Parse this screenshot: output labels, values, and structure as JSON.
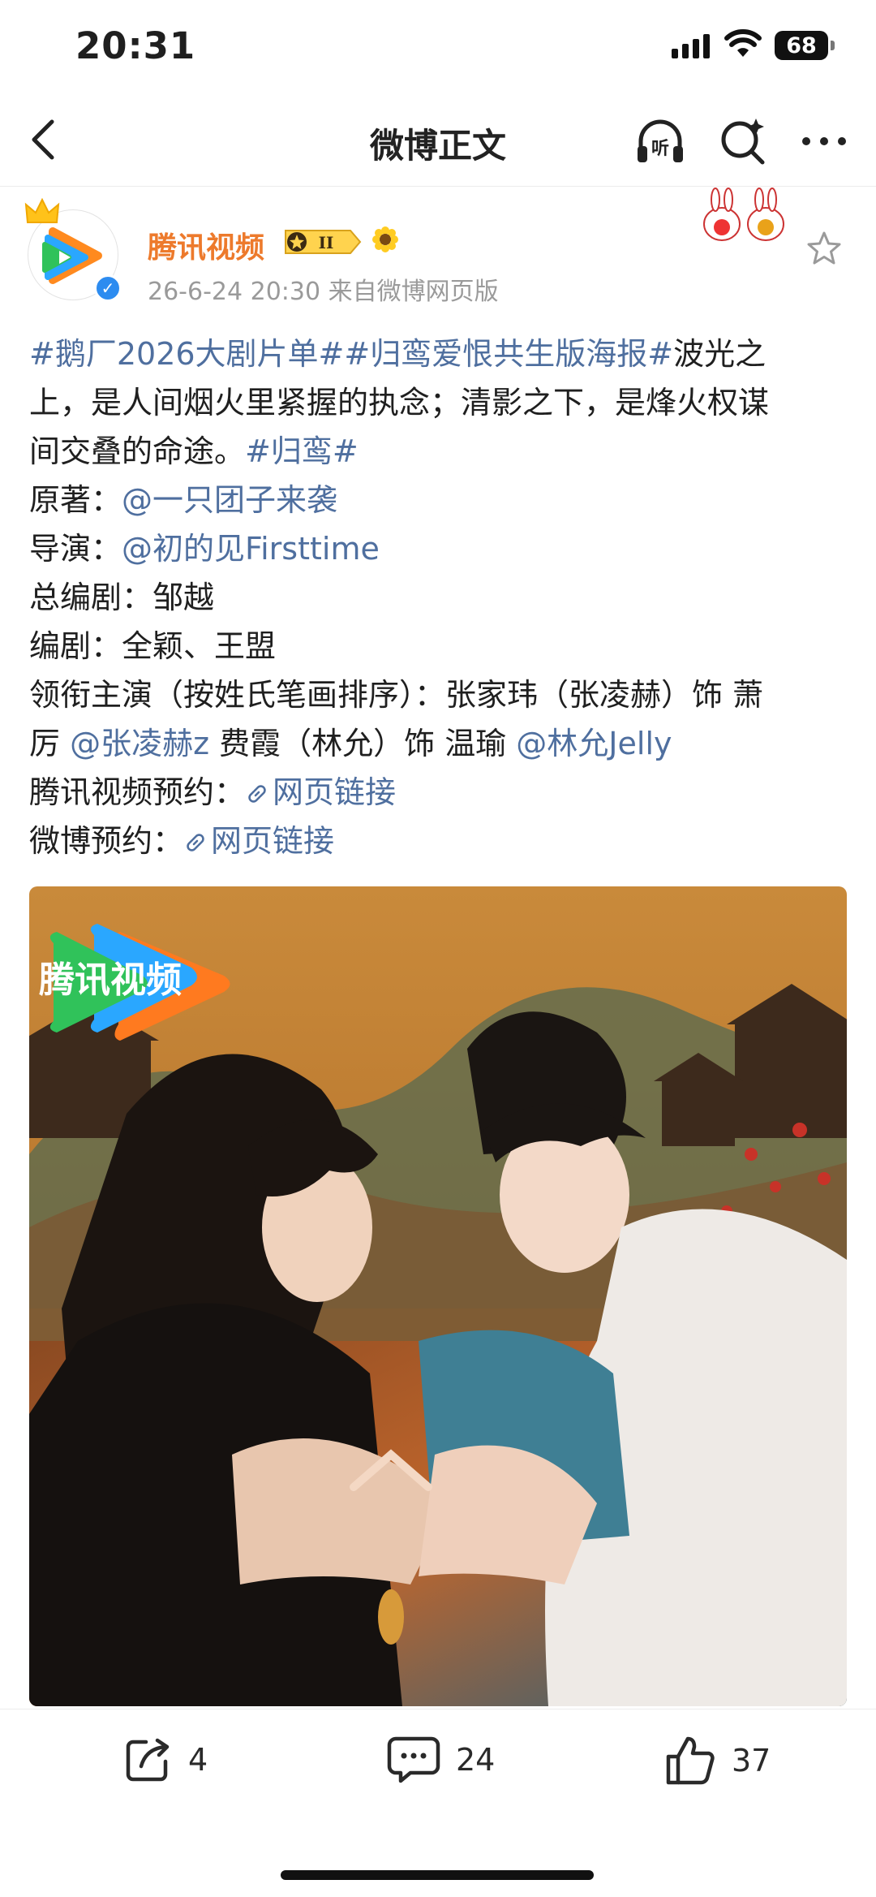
{
  "status": {
    "time": "20:31",
    "battery": "68"
  },
  "nav": {
    "title": "微博正文",
    "listen_label": "听"
  },
  "post": {
    "username": "腾讯视频",
    "vip_level": "II",
    "meta": "26-6-24 20:30  来自微博网页版",
    "line1_tag1": "#鹅厂2026大剧片单#",
    "line1_tag2": "#归鸾爱恨共生版海报#",
    "line1_text": "波光之",
    "line2": "上，是人间烟火里紧握的执念；清影之下，是烽火权谋",
    "line3_text": "间交叠的命途。",
    "line3_tag": "#归鸾#",
    "line4_label": "原著：",
    "line4_mention": "@一只团子来袭",
    "line5_label": "导演：",
    "line5_mention": "@初的见Firsttime",
    "line6": "总编剧：邹越",
    "line7": "编剧：全颖、王盟",
    "line8": "领衔主演（按姓氏笔画排序）：张家玮（张凌赫）饰 萧",
    "line9_text1": "厉 ",
    "line9_mention1": "@张凌赫z",
    "line9_text2": " 费霞（林允）饰 温瑜 ",
    "line9_mention2": "@林允Jelly",
    "line10_label": "腾讯视频预约：",
    "line10_link": "网页链接",
    "line11_label": "微博预约：",
    "line11_link": "网页链接",
    "poster_logo": "腾讯视频"
  },
  "actions": {
    "forward_count": "4",
    "comment_count": "24",
    "like_count": "37"
  },
  "colors": {
    "accent_link": "#4f6f9f",
    "username": "#ed7a2c"
  }
}
